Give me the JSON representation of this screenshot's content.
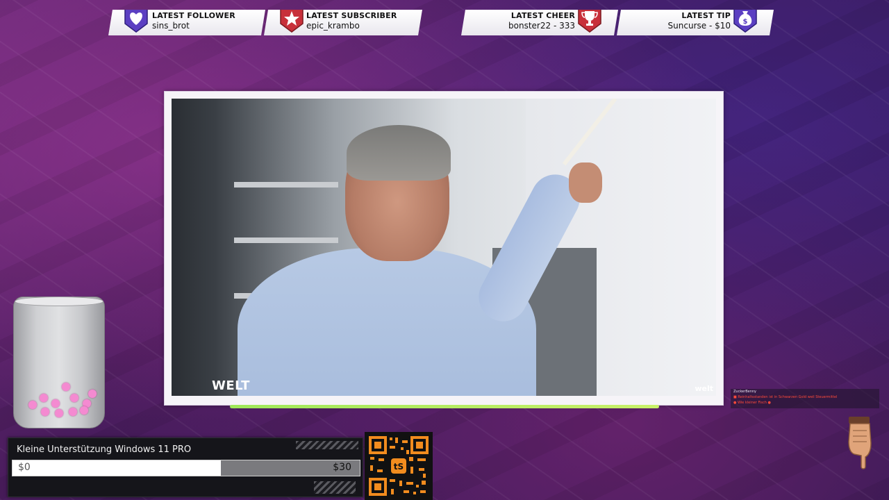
{
  "alerts": [
    {
      "title": "LATEST FOLLOWER",
      "value": "sins_brot",
      "icon": "heart-badge-icon",
      "color": "#5b3fc2"
    },
    {
      "title": "LATEST SUBSCRIBER",
      "value": "epic_krambo",
      "icon": "star-badge-icon",
      "color": "#c8303a"
    },
    {
      "title": "LATEST CHEER",
      "value": "bonster22 - 333",
      "icon": "trophy-badge-icon",
      "color": "#c8303a"
    },
    {
      "title": "LATEST TIP",
      "value": "Suncurse - $10",
      "icon": "money-bag-badge-icon",
      "color": "#5b3fc2"
    }
  ],
  "video": {
    "watermark": "WELT",
    "watermark_small": "welt"
  },
  "goal": {
    "title": "Kleine Unterstützung Windows 11 PRO",
    "start_label": "$0",
    "end_label": "$30",
    "progress": 0.6
  },
  "chat": {
    "name_line": "ZuckerBenny",
    "lines": [
      "■ Reinhaltsstanden ist in Schwarzen Gold weil Steuermittel",
      "● Wie kleiner Fisch ●"
    ]
  },
  "qr": {
    "icon": "qr-code-icon",
    "logo_text": "tS"
  },
  "colors": {
    "accent_green": "#a8ec5e",
    "badge_purple": "#5b3fc2",
    "badge_red": "#c8303a",
    "qr_orange": "#f28c1e"
  }
}
